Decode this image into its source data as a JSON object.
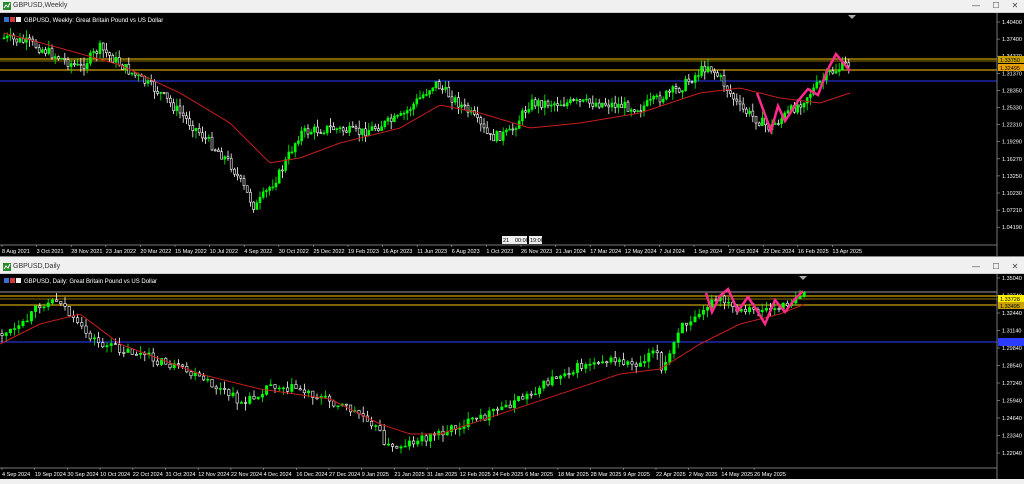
{
  "top_window": {
    "title": "GBPUSD,Weekly",
    "chart_label": "GBPUSD, Weekly: Great Britain Pound vs US Dollar",
    "price_ticks": [
      "1.40400",
      "1.37400",
      "1.34370",
      "1.31370",
      "1.28350",
      "1.25330",
      "1.22310",
      "1.19290",
      "1.16270",
      "1.13250",
      "1.10230",
      "1.07210",
      "1.04190"
    ],
    "price_badges": [
      "1.33750",
      "1.32495"
    ],
    "date_ticks": [
      "8 Aug 2021",
      "3 Oct 2021",
      "28 Nov 2021",
      "23 Jan 2022",
      "20 Mar 2022",
      "15 May 2022",
      "10 Jul 2022",
      "4 Sep 2022",
      "30 Oct 2022",
      "25 Dec 2022",
      "19 Feb 2023",
      "16 Apr 2023",
      "11 Jun 2023",
      "6 Aug 2023",
      "1 Oct 2023",
      "26 Nov 2023",
      "21 Jan 2024",
      "17 Mar 2024",
      "12 May 2024",
      "7 Jul 2024",
      "1 Sep 2024",
      "27 Oct 2024",
      "22 Dec 2024",
      "16 Feb 2025",
      "13 Apr 2025"
    ],
    "crosshair_labels": [
      "21 ",
      "00:00",
      "19:00"
    ]
  },
  "bottom_window": {
    "title": "GBPUSD,Daily",
    "chart_label": "GBPUSD, Daily: Great Britain Pound vs US Dollar",
    "price_ticks": [
      "1.35040",
      "1.33740",
      "1.32440",
      "1.31140",
      "1.29840",
      "1.28540",
      "1.27240",
      "1.25940",
      "1.24640",
      "1.23340",
      "1.22040"
    ],
    "price_badges": [
      "1.33728",
      "1.33495"
    ],
    "date_ticks": [
      "4 Sep 2024",
      "19 Sep 2024",
      "30 Sep 2024",
      "10 Oct 2024",
      "22 Oct 2024",
      "31 Oct 2024",
      "12 Nov 2024",
      "22 Nov 2024",
      "4 Dec 2024",
      "16 Dec 2024",
      "27 Dec 2024",
      "9 Jan 2025",
      "21 Jan 2025",
      "31 Jan 2025",
      "12 Feb 2025",
      "24 Feb 2025",
      "6 Mar 2025",
      "18 Mar 2025",
      "28 Mar 2025",
      "9 Apr 2025",
      "22 Apr 2025",
      "2 May 2025",
      "14 May 2025",
      "26 May 2025"
    ]
  },
  "window_buttons": {
    "minimize": "—",
    "maximize": "☐",
    "close": "✕"
  },
  "colors": {
    "background": "#000000",
    "bull_candle": "#00ff00",
    "bear_candle": "#ffffff",
    "moving_average": "#c81e1e",
    "pattern": "#ff2a8a",
    "resistance": "#c8a000",
    "blue_level": "#2c3cff"
  }
}
